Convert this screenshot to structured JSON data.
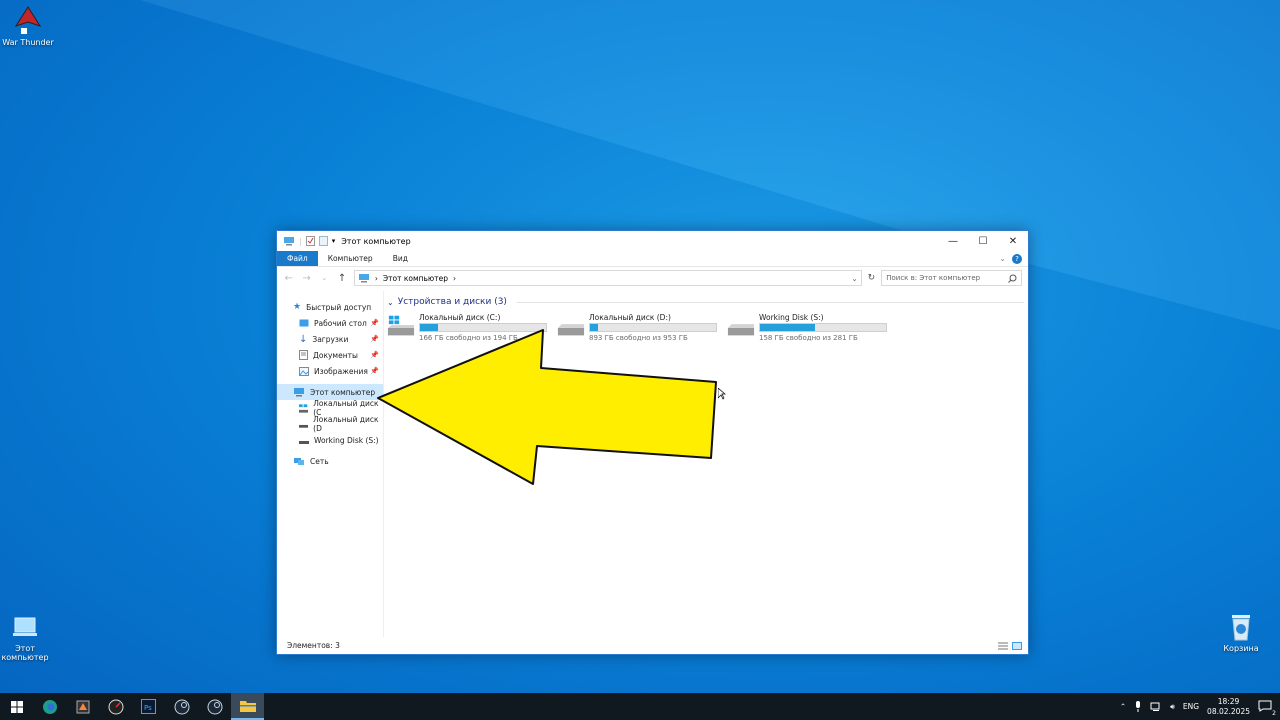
{
  "desktop": {
    "icons": [
      {
        "label": "War Thunder"
      },
      {
        "label": "Этот компьютер"
      },
      {
        "label": "Корзина"
      }
    ]
  },
  "window": {
    "title": "Этот компьютер",
    "ribbon_tabs": [
      "Файл",
      "Компьютер",
      "Вид"
    ],
    "address": "Этот компьютер",
    "search_placeholder": "Поиск в: Этот компьютер",
    "sidebar": [
      {
        "label": "Быстрый доступ"
      },
      {
        "label": "Рабочий стол"
      },
      {
        "label": "Загрузки"
      },
      {
        "label": "Документы"
      },
      {
        "label": "Изображения"
      },
      {
        "label": "Этот компьютер"
      },
      {
        "label": "Локальный диск (C"
      },
      {
        "label": "Локальный диск (D"
      },
      {
        "label": "Working Disk (S:)"
      },
      {
        "label": "Сеть"
      }
    ],
    "group_header": "Устройства и диски (3)",
    "drives": [
      {
        "name": "Локальный диск (C:)",
        "free": "166 ГБ свободно из 194 ГБ",
        "used_fraction": 0.14
      },
      {
        "name": "Локальный диск (D:)",
        "free": "893 ГБ свободно из 953 ГБ",
        "used_fraction": 0.06
      },
      {
        "name": "Working Disk (S:)",
        "free": "158 ГБ свободно из 281 ГБ",
        "used_fraction": 0.44
      }
    ],
    "status": "Элементов: 3"
  },
  "taskbar": {
    "lang": "ENG",
    "time": "18:29",
    "date": "08.02.2025",
    "notifications": "2"
  },
  "colors": {
    "accent": "#1979ca",
    "arrow": "#ffee00",
    "desktop": "#0a86dc"
  }
}
